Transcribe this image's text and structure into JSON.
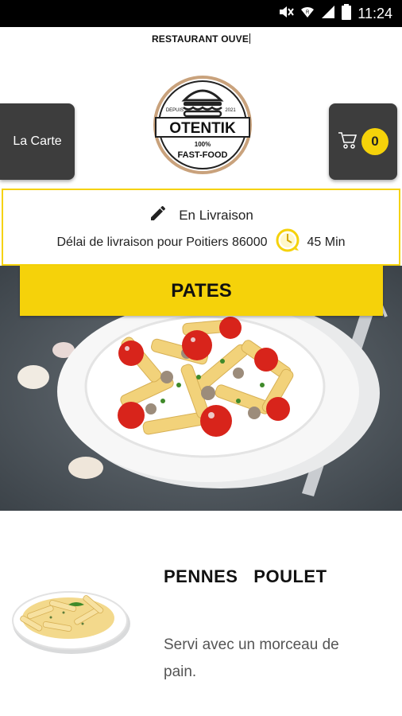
{
  "status_bar": {
    "time": "11:24",
    "icons": [
      "mute-icon",
      "wifi-icon",
      "signal-icon",
      "battery-icon"
    ]
  },
  "header": {
    "restaurant_status": "RESTAURANT OUVE",
    "menu_label": "La Carte",
    "cart_count": "0",
    "logo": {
      "brand": "OTENTIK",
      "tagline": "FAST-FOOD",
      "subline": "100%",
      "since_left": "DEPUIS",
      "since_right": "2021"
    }
  },
  "delivery": {
    "mode": "En Livraison",
    "info": "Délai de livraison pour Poitiers 86000",
    "time": "45 Min"
  },
  "category": {
    "title": "PATES"
  },
  "product": {
    "name": "PENNES   POULET",
    "description": "Servi avec un morceau de pain."
  },
  "colors": {
    "accent": "#f5d20a",
    "button_bg": "#3d3d3d",
    "status_bar": "#000000"
  }
}
